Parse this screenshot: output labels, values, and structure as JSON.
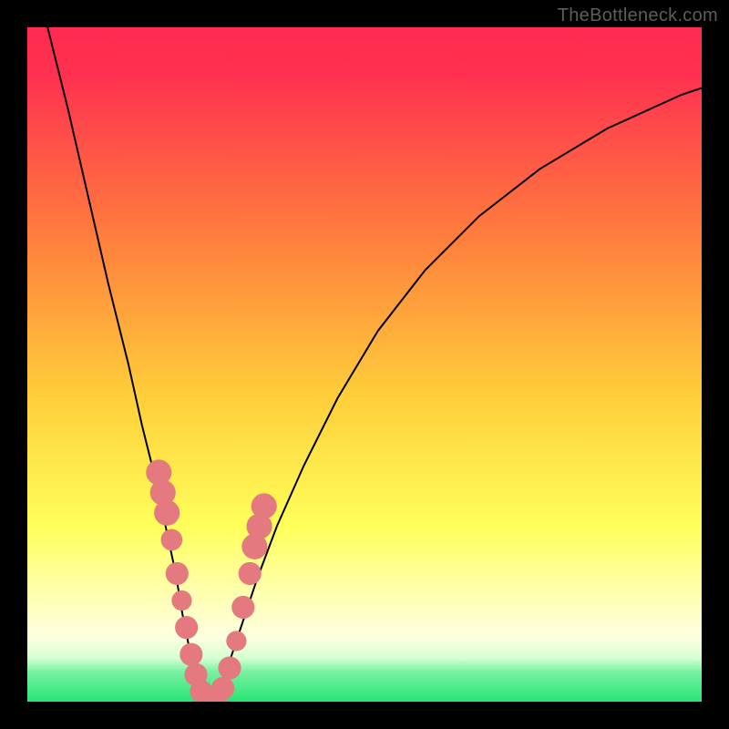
{
  "watermark": "TheBottleneck.com",
  "colors": {
    "bg_frame": "#000000",
    "grad_top": "#ff2b50",
    "grad_mid_upper": "#ff8a3a",
    "grad_mid": "#ffde3a",
    "grad_mid_lower": "#ffff8a",
    "grad_pale": "#fbffd8",
    "grad_green": "#2fe879",
    "curve": "#000000",
    "bead": "#e47a7f"
  },
  "chart_data": {
    "type": "line",
    "title": "",
    "xlabel": "",
    "ylabel": "",
    "xlim": [
      0,
      100
    ],
    "ylim": [
      0,
      100
    ],
    "note": "x and y are normalized 0–100 across the visible colored plot area; y=0 is the bottom (green band), y=100 is the top (red). The curve is a V-shaped well with minimum near x≈26, y≈0, rising steeply on both sides. Values below are visually estimated from the image.",
    "series": [
      {
        "name": "left-branch",
        "x": [
          3,
          6,
          9,
          12,
          15,
          17,
          19,
          20.5,
          22,
          23,
          24,
          25,
          26
        ],
        "y": [
          100,
          88,
          75,
          62,
          50,
          41,
          33,
          26,
          19,
          13,
          8,
          3,
          0
        ]
      },
      {
        "name": "right-branch",
        "x": [
          28,
          30,
          32,
          34,
          37,
          41,
          46,
          52,
          59,
          67,
          76,
          86,
          97,
          100
        ],
        "y": [
          0,
          6,
          12,
          18,
          26,
          35,
          45,
          55,
          64,
          72,
          79,
          85,
          90,
          91
        ]
      }
    ],
    "markers": {
      "name": "beads",
      "note": "Salmon-colored capsule/dot markers clustered along both branches near the bottom of the V.",
      "points": [
        {
          "x": 19.5,
          "y": 34,
          "r": 1.9
        },
        {
          "x": 20.1,
          "y": 31,
          "r": 1.9
        },
        {
          "x": 20.7,
          "y": 28,
          "r": 1.9
        },
        {
          "x": 21.4,
          "y": 24,
          "r": 1.6
        },
        {
          "x": 22.2,
          "y": 19,
          "r": 1.7
        },
        {
          "x": 22.9,
          "y": 15,
          "r": 1.5
        },
        {
          "x": 23.6,
          "y": 11,
          "r": 1.7
        },
        {
          "x": 24.3,
          "y": 7,
          "r": 1.7
        },
        {
          "x": 25.0,
          "y": 4,
          "r": 1.7
        },
        {
          "x": 25.8,
          "y": 1.5,
          "r": 1.7
        },
        {
          "x": 26.8,
          "y": 0.5,
          "r": 1.7
        },
        {
          "x": 27.9,
          "y": 0.5,
          "r": 1.7
        },
        {
          "x": 29.0,
          "y": 2,
          "r": 1.7
        },
        {
          "x": 30.0,
          "y": 5,
          "r": 1.7
        },
        {
          "x": 31.0,
          "y": 9,
          "r": 1.5
        },
        {
          "x": 32.0,
          "y": 14,
          "r": 1.7
        },
        {
          "x": 33.0,
          "y": 19,
          "r": 1.7
        },
        {
          "x": 33.7,
          "y": 23,
          "r": 1.9
        },
        {
          "x": 34.4,
          "y": 26,
          "r": 1.9
        },
        {
          "x": 35.1,
          "y": 29,
          "r": 1.9
        }
      ]
    },
    "gradient_bands": [
      {
        "y_from": 93,
        "y_to": 100,
        "color": "#ff2b50"
      },
      {
        "y_from": 55,
        "y_to": 93,
        "color": "gradient red→orange"
      },
      {
        "y_from": 20,
        "y_to": 55,
        "color": "gradient orange→yellow"
      },
      {
        "y_from": 7,
        "y_to": 20,
        "color": "pale yellow / cream"
      },
      {
        "y_from": 0,
        "y_to": 7,
        "color": "#2fe879"
      }
    ]
  }
}
